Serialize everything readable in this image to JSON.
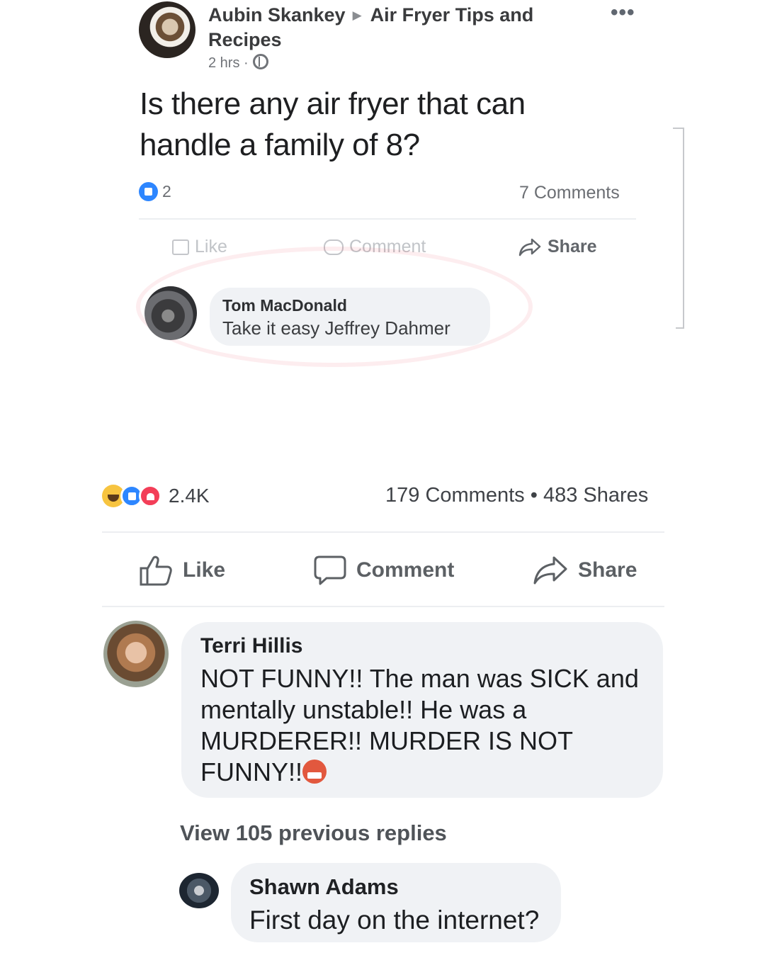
{
  "inner_post": {
    "author": "Aubin Skankey",
    "group": "Air Fryer Tips and Recipes",
    "group_line1": "Air Fryer Tips and",
    "group_line2": "Recipes",
    "time": "2 hrs ·",
    "privacy_icon": "globe-icon",
    "more_icon": "more-options-icon",
    "text_line1": "Is there any air fryer that can",
    "text_line2": "handle a family of 8?",
    "reaction_count": "2",
    "comments_count": "7 Comments",
    "actions": {
      "like": "Like",
      "comment": "Comment",
      "share": "Share"
    },
    "comment": {
      "name": "Tom MacDonald",
      "text": "Take it easy Jeffrey Dahmer"
    }
  },
  "outer_post": {
    "reactions_count": "2.4K",
    "reaction_icons": [
      "haha-icon",
      "like-icon",
      "love-icon"
    ],
    "comments_count": "179 Comments",
    "separator": "•",
    "shares_count": "483 Shares",
    "actions": {
      "like": "Like",
      "comment": "Comment",
      "share": "Share"
    }
  },
  "comments": [
    {
      "name": "Terri Hillis",
      "text_lines": [
        "NOT FUNNY!! The man was SICK and",
        "mentally unstable!! He was a",
        "MURDERER!! MURDER IS NOT",
        "FUNNY!!"
      ],
      "emoji": "angry-emoji"
    }
  ],
  "view_replies": "View 105 previous replies",
  "reply": {
    "name": "Shawn Adams",
    "text": "First day on the internet?"
  },
  "colors": {
    "like_blue": "#2d86ff",
    "love_red": "#f33e58",
    "haha_yellow": "#f7c440",
    "bubble_bg": "#f0f2f5",
    "secondary_text": "#6b6e73"
  }
}
